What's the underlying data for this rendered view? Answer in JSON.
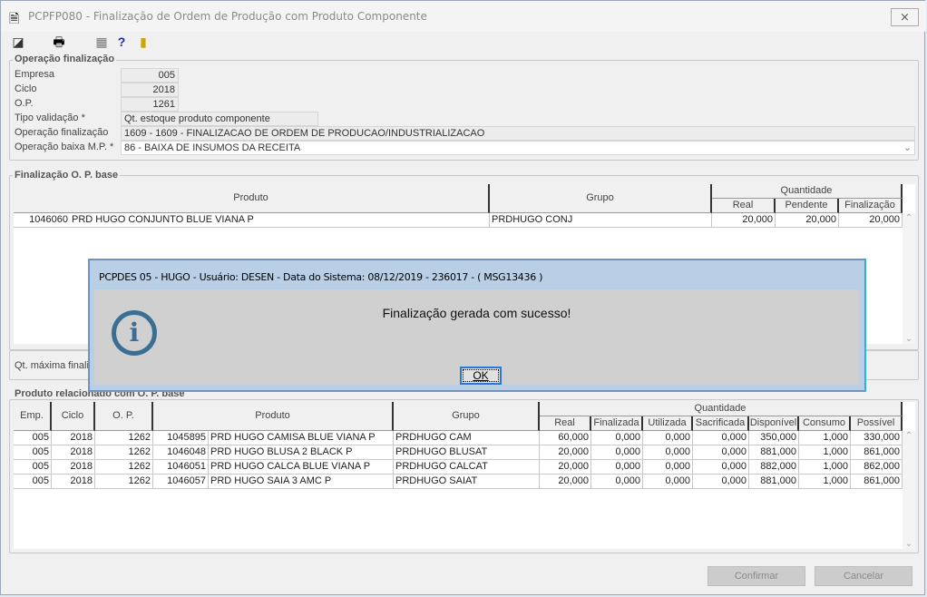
{
  "window": {
    "title": "PCPFP080 - Finalização de Ordem de Produção com Produto Componente",
    "close_label": "⨯"
  },
  "toolbar": {
    "icons": [
      "export-icon",
      "print-icon",
      "calendar-icon",
      "help-icon",
      "exit-door-icon"
    ]
  },
  "operacao": {
    "legend": "Operação finalização",
    "empresa_label": "Empresa",
    "empresa": "005",
    "ciclo_label": "Ciclo",
    "ciclo": "2018",
    "op_label": "O.P.",
    "op": "1261",
    "tipo_label": "Tipo validação *",
    "tipo": "Qt. estoque produto componente",
    "opfin_label": "Operação finalização",
    "opfin": "1609 - 1609 - FINALIZACAO DE ORDEM DE PRODUCAO/INDUSTRIALIZACAO",
    "opbaixa_label": "Operação baixa M.P. *",
    "opbaixa": "86 - BAIXA DE INSUMOS DA RECEITA"
  },
  "base": {
    "legend": "Finalização O. P. base",
    "headers": {
      "produto": "Produto",
      "grupo": "Grupo",
      "quantidade": "Quantidade",
      "real": "Real",
      "pendente": "Pendente",
      "finalizacao": "Finalização"
    },
    "rows": [
      {
        "codigo": "1046060",
        "produto": "PRD HUGO CONJUNTO BLUE VIANA P",
        "grupo": "PRDHUGO CONJ",
        "real": "20,000",
        "pendente": "20,000",
        "finalizacao": "20,000"
      }
    ],
    "qt_label": "Qt. máxima finaliz"
  },
  "related": {
    "legend": "Produto relacionado com O. P. base",
    "headers": {
      "emp": "Emp.",
      "ciclo": "Ciclo",
      "op": "O. P.",
      "produto": "Produto",
      "grupo": "Grupo",
      "quantidade": "Quantidade",
      "real": "Real",
      "finalizada": "Finalizada",
      "utilizada": "Utilizada",
      "sacrificada": "Sacrificada",
      "disponivel": "Disponível",
      "consumo": "Consumo",
      "possivel": "Possível"
    },
    "rows": [
      {
        "emp": "005",
        "ciclo": "2018",
        "op": "1262",
        "codigo": "1045895",
        "produto": "PRD HUGO CAMISA BLUE VIANA P",
        "grupo": "PRDHUGO CAM",
        "real": "60,000",
        "finalizada": "0,000",
        "utilizada": "0,000",
        "sacrificada": "0,000",
        "disponivel": "350,000",
        "consumo": "1,000",
        "possivel": "330,000"
      },
      {
        "emp": "005",
        "ciclo": "2018",
        "op": "1262",
        "codigo": "1046048",
        "produto": "PRD HUGO BLUSA 2 BLACK P",
        "grupo": "PRDHUGO BLUSAT",
        "real": "20,000",
        "finalizada": "0,000",
        "utilizada": "0,000",
        "sacrificada": "0,000",
        "disponivel": "881,000",
        "consumo": "1,000",
        "possivel": "861,000"
      },
      {
        "emp": "005",
        "ciclo": "2018",
        "op": "1262",
        "codigo": "1046051",
        "produto": "PRD HUGO CALCA BLUE VIANA P",
        "grupo": "PRDHUGO CALCAT",
        "real": "20,000",
        "finalizada": "0,000",
        "utilizada": "0,000",
        "sacrificada": "0,000",
        "disponivel": "882,000",
        "consumo": "1,000",
        "possivel": "862,000"
      },
      {
        "emp": "005",
        "ciclo": "2018",
        "op": "1262",
        "codigo": "1046057",
        "produto": "PRD HUGO SAIA 3 AMC P",
        "grupo": "PRDHUGO SAIAT",
        "real": "20,000",
        "finalizada": "0,000",
        "utilizada": "0,000",
        "sacrificada": "0,000",
        "disponivel": "881,000",
        "consumo": "1,000",
        "possivel": "861,000"
      }
    ]
  },
  "buttons": {
    "confirmar": "Confirmar",
    "cancelar": "Cancelar"
  },
  "dialog": {
    "title": "PCPDES 05 - HUGO - Usuário: DESEN - Data do Sistema: 08/12/2019 - 236017 - ( MSG13436 )",
    "message": "Finalização gerada com sucesso!",
    "ok": "OK",
    "icon": "info-icon"
  }
}
